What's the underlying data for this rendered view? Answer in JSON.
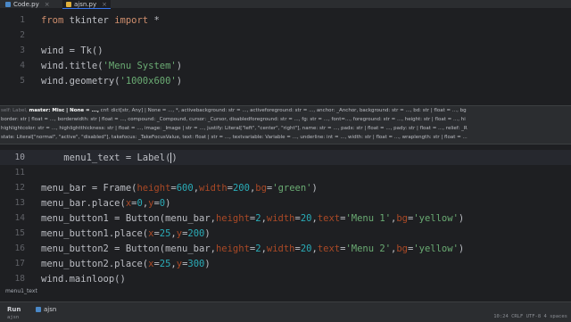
{
  "tabs": [
    {
      "label": "Code.py",
      "active": false
    },
    {
      "label": "ajsn.py",
      "active": true
    }
  ],
  "lines": [
    {
      "n": "1",
      "code": "from tkinter import *"
    },
    {
      "n": "2",
      "code": ""
    },
    {
      "n": "3",
      "code": "wind = Tk()"
    },
    {
      "n": "4",
      "code": "wind.title('Menu System')"
    },
    {
      "n": "5",
      "code": "wind.geometry('1000x600')"
    },
    {
      "n": "10",
      "code": "menu1_text = Label()"
    },
    {
      "n": "11",
      "code": ""
    },
    {
      "n": "12",
      "code": "menu_bar = Frame(height=600,width=200,bg='green')"
    },
    {
      "n": "13",
      "code": "menu_bar.place(x=0,y=0)"
    },
    {
      "n": "14",
      "code": "menu_button1 = Button(menu_bar,height=2,width=20,text='Menu 1',bg='yellow')"
    },
    {
      "n": "15",
      "code": "menu_button1.place(x=25,y=200)"
    },
    {
      "n": "16",
      "code": "menu_button2 = Button(menu_bar,height=2,width=20,text='Menu 2',bg='yellow')"
    },
    {
      "n": "17",
      "code": "menu_button2.place(x=25,y=300)"
    },
    {
      "n": "18",
      "code": "wind.mainloop()"
    },
    {
      "n": "19",
      "code": ""
    }
  ],
  "tooltip": {
    "line1_prefix": "self: Label,",
    "line1_bold": "master: Misc | None = ...,",
    "line1_rest": " cnf: dict[str, Any] | None = ..., *, activebackground: str = ..., activeforeground: str = ..., anchor: _Anchor, background: str = ..., bd: str | float = ..., bg",
    "line2": "border: str | float = ..., borderwidth: str | float = ..., compound: _Compound, cursor: _Cursor, disabledforeground: str = ..., fg: str = ..., font=..., foreground: str = ..., height: str | float = ..., hi",
    "line3": "highlightcolor: str = ..., highlightthickness: str | float = ..., image: _Image | str = ..., justify: Literal[\"left\", \"center\", \"right\"], name: str = ..., padx: str | float = ..., pady: str | float = ..., relief: _R",
    "line4": "state: Literal[\"normal\", \"active\", \"disabled\"], takefocus: _TakeFocusValue, text: float | str = ..., textvariable: Variable = ..., underline: int = ..., width: str | float = ..., wraplength: str | float = ..."
  },
  "hover_text": "menu1_text",
  "run": {
    "label": "Run",
    "tab": "ajsn"
  },
  "status": {
    "left": "ajsn",
    "right": "10:24  CRLF  UTF-8  4 spaces"
  },
  "colors": {
    "keyword": "#cf8e6d",
    "string": "#6aab73",
    "number": "#2aacb8",
    "param": "#aa4926"
  }
}
